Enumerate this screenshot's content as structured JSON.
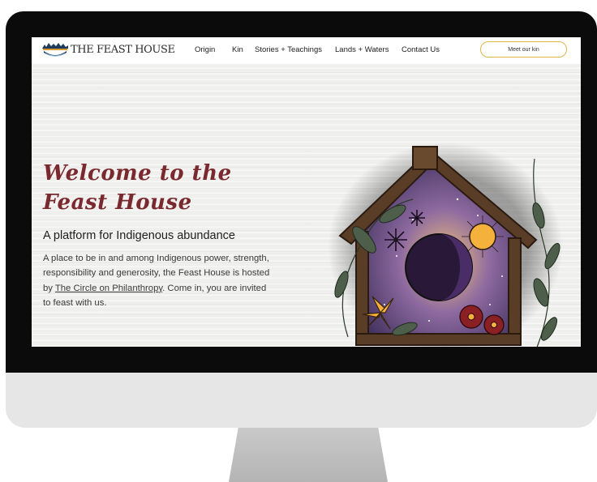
{
  "nav": {
    "logo_text": "THE FEAST HOUSE",
    "links": [
      "Origin",
      "Kin",
      "Stories + Teachings",
      "Lands + Waters",
      "Contact Us"
    ],
    "cta_label": "Meet our kin"
  },
  "hero": {
    "headline": "Welcome to the Feast House",
    "subheading": "A platform for Indigenous abundance",
    "body_prefix": "A place to be in and among Indigenous power, strength, responsibility and generosity, the Feast House is hosted by ",
    "body_link": "The Circle on Philanthropy",
    "body_suffix": ". Come in, you are invited to feast with us."
  },
  "colors": {
    "accent": "#7a2a2e",
    "button_border": "#e0b44a",
    "bezel": "#0b0b0b",
    "chin": "#e6e6e6"
  },
  "icons": [
    "feast-house-logo-icon",
    "house-illustration"
  ]
}
